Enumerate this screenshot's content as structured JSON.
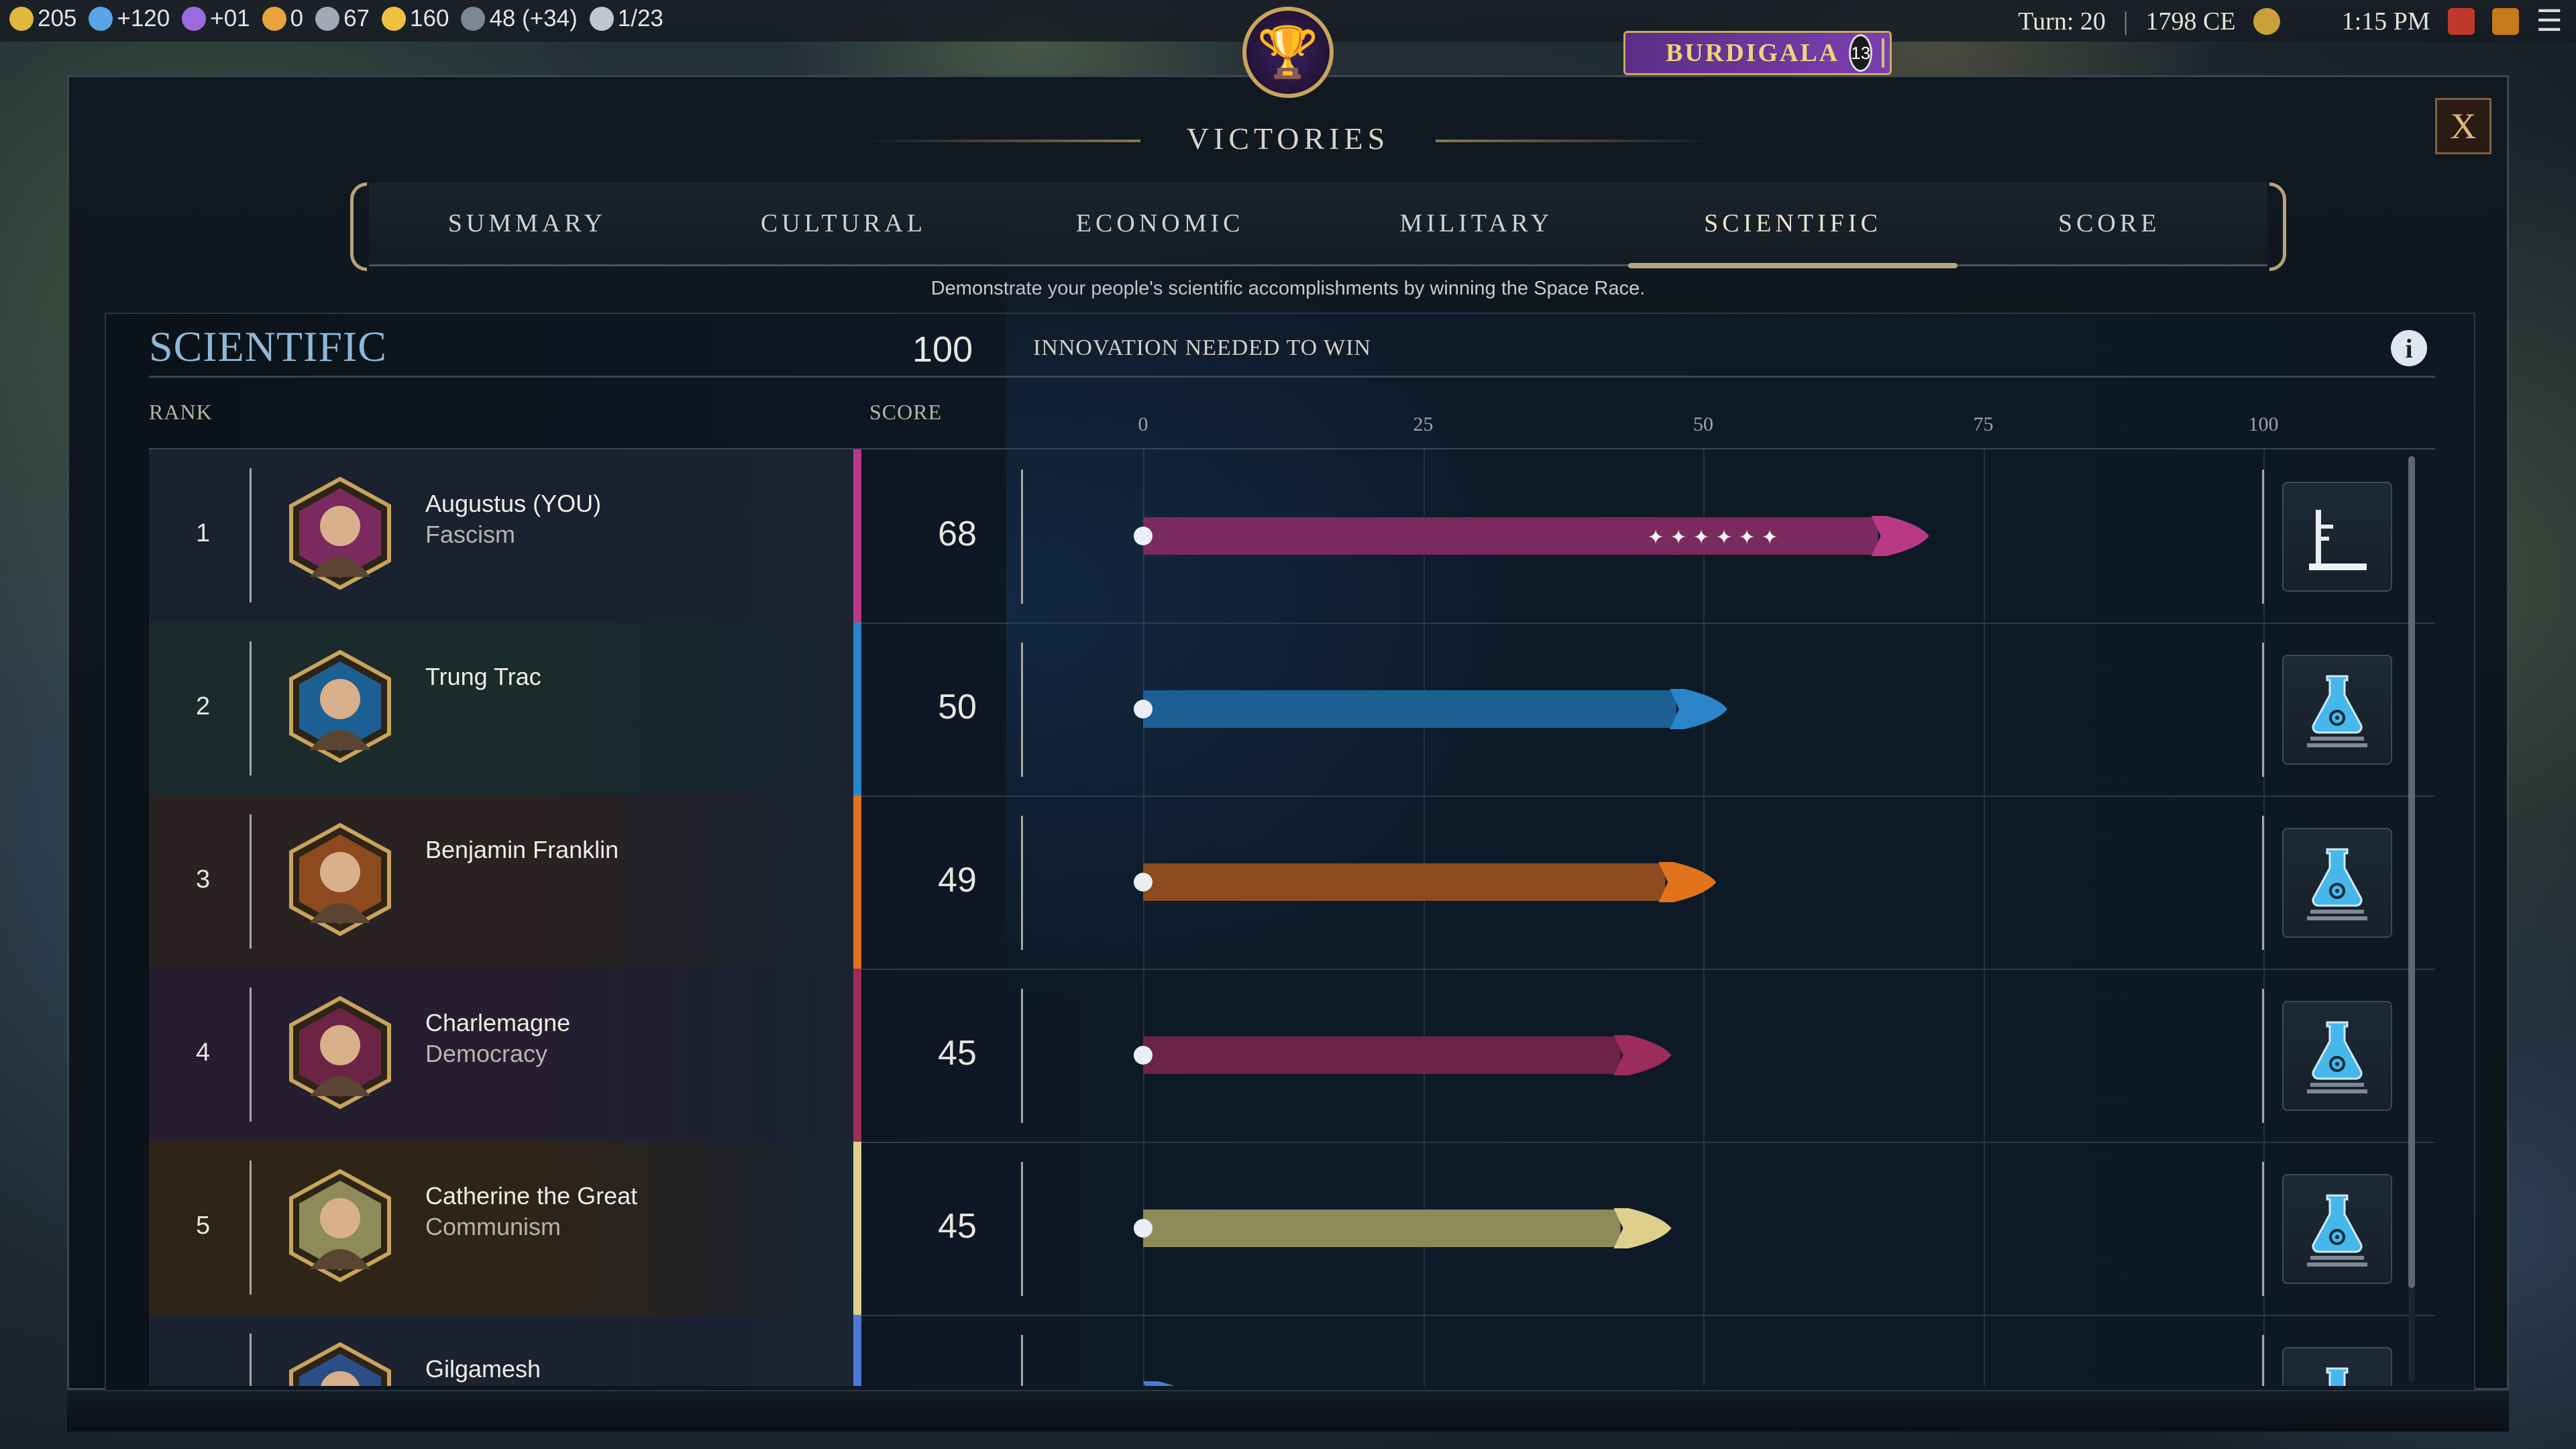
{
  "topbar": {
    "yields": [
      {
        "icon": "gold-icon",
        "text": "205",
        "color": "#e0b93c"
      },
      {
        "icon": "science-icon",
        "text": "+120",
        "color": "#58a6e8"
      },
      {
        "icon": "culture-icon",
        "text": "+01",
        "color": "#9d6be0"
      },
      {
        "icon": "happiness-icon",
        "text": "0",
        "color": "#e8a43a"
      },
      {
        "icon": "influence-icon",
        "text": "67",
        "color": "#a0aab5"
      },
      {
        "icon": "happiness-face-icon",
        "text": "160",
        "color": "#f0c040"
      },
      {
        "icon": "globe-icon",
        "text": "48 (+34)",
        "color": "#7a8894"
      },
      {
        "icon": "settlement-icon",
        "text": "1/23",
        "color": "#c0c6cc"
      }
    ],
    "turn": "Turn: 20",
    "year": "1798 CE",
    "time": "1:15 PM"
  },
  "city_banner": {
    "name": "BURDIGALA",
    "population": "13"
  },
  "modal": {
    "title": "VICTORIES",
    "close": "X",
    "tabs": [
      "SUMMARY",
      "CULTURAL",
      "ECONOMIC",
      "MILITARY",
      "SCIENTIFIC",
      "SCORE"
    ],
    "active_tab": "SCIENTIFIC",
    "description": "Demonstrate your people's scientific accomplishments by winning the Space Race."
  },
  "panel": {
    "category": "SCIENTIFIC",
    "needed_value": "100",
    "needed_label": "INNOVATION NEEDED TO WIN",
    "col_rank": "RANK",
    "col_score": "SCORE",
    "axis_ticks": [
      "0",
      "25",
      "50",
      "75",
      "100"
    ]
  },
  "chart_data": {
    "type": "bar",
    "orientation": "horizontal",
    "xlim": [
      0,
      100
    ],
    "categories": [
      "Augustus (YOU)",
      "Trung Trac",
      "Benjamin Franklin",
      "Charlemagne",
      "Catherine the Great",
      "Gilgamesh"
    ],
    "values": [
      68,
      50,
      49,
      45,
      45,
      null
    ]
  },
  "rows": [
    {
      "rank": "1",
      "name": "Augustus (YOU)",
      "gov": "Fascism",
      "score": "68",
      "value": 68,
      "color": "#b83a86",
      "bar": "#7a2a5e",
      "status": "launch-tower-icon",
      "bg": "#1a2230"
    },
    {
      "rank": "2",
      "name": "Trung Trac",
      "gov": "",
      "score": "50",
      "value": 50,
      "color": "#2a86c8",
      "bar": "#1c5f92",
      "status": "science-flask-icon",
      "bg": "#1b2a2a"
    },
    {
      "rank": "3",
      "name": "Benjamin Franklin",
      "gov": "",
      "score": "49",
      "value": 49,
      "color": "#e0731c",
      "bar": "#8c4a1e",
      "status": "science-flask-icon",
      "bg": "#2a2222"
    },
    {
      "rank": "4",
      "name": "Charlemagne",
      "gov": "Democracy",
      "score": "45",
      "value": 45,
      "color": "#9c2c5a",
      "bar": "#6c2444",
      "status": "science-flask-icon",
      "bg": "#241e30"
    },
    {
      "rank": "5",
      "name": "Catherine the Great",
      "gov": "Communism",
      "score": "45",
      "value": 45,
      "color": "#ddd08a",
      "bar": "#8f8a5a",
      "status": "science-flask-icon",
      "bg": "#2e2418"
    },
    {
      "rank": "",
      "name": "Gilgamesh",
      "gov": "",
      "score": "",
      "value": null,
      "color": "#4a7ad8",
      "bar": "#2c4e88",
      "status": "science-flask-icon",
      "bg": "#1c2230"
    }
  ]
}
